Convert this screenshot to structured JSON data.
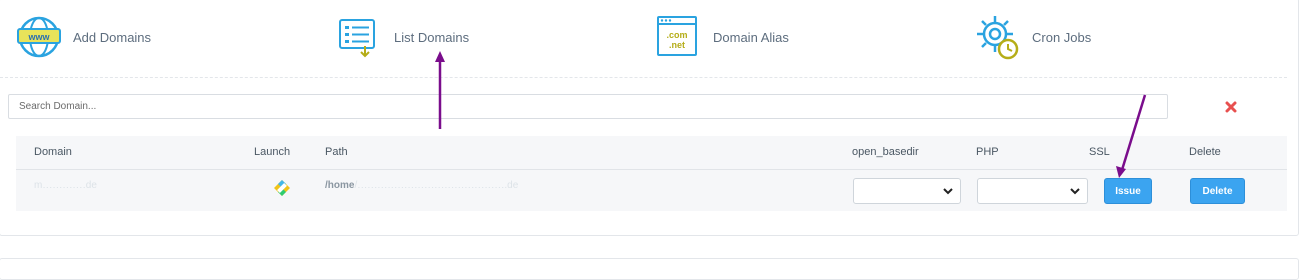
{
  "nav": {
    "items": [
      {
        "label": "Add Domains",
        "icon": "www-globe-icon"
      },
      {
        "label": "List Domains",
        "icon": "list-document-icon"
      },
      {
        "label": "Domain Alias",
        "icon": "domain-alias-icon"
      },
      {
        "label": "Cron Jobs",
        "icon": "cron-gear-clock-icon"
      }
    ],
    "alias_icon_text": {
      "line1": ".com",
      "line2": ".net"
    },
    "globe_text": "www"
  },
  "search": {
    "placeholder": "Search Domain..."
  },
  "table": {
    "columns": {
      "domain": "Domain",
      "launch": "Launch",
      "path": "Path",
      "open_basedir": "open_basedir",
      "php": "PHP",
      "ssl": "SSL",
      "delete": "Delete"
    },
    "rows": [
      {
        "domain": "m․․․․․․․․․․․․․de",
        "path_prefix": "/home",
        "path_rest": "/․․․․․․․․․․․․․․․․․․․․․․․․․․․․․․․․․․․․․․․․․․․․.de",
        "open_basedir": "",
        "php": "",
        "ssl_button": "Issue",
        "delete_button": "Delete"
      }
    ]
  },
  "colors": {
    "accent": "#3ba4f0",
    "annotation_arrow": "#7a0d8c",
    "clear_x": "#e8504f",
    "icon_blue": "#2aa3e0",
    "icon_yellow": "#c8c21c"
  }
}
